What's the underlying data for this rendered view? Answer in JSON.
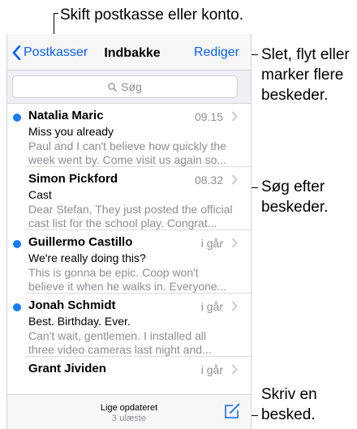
{
  "callouts": {
    "top": "Skift postkasse eller konto.",
    "edit": [
      "Slet, flyt eller",
      "marker flere",
      "beskeder."
    ],
    "search": [
      "Søg efter",
      "beskeder."
    ],
    "compose": [
      "Skriv en",
      "besked."
    ]
  },
  "navbar": {
    "back_label": "Postkasser",
    "title": "Indbakke",
    "edit_label": "Rediger"
  },
  "search": {
    "placeholder": "Søg"
  },
  "messages": [
    {
      "sender": "Natalia Maric",
      "time": "09.15",
      "subject": "Miss you already",
      "preview": [
        "Paul and I can't believe how quickly the",
        "week went by. Come visit us again so..."
      ],
      "unread": true
    },
    {
      "sender": "Simon Pickford",
      "time": "08.32",
      "subject": "Cast",
      "preview": [
        "Dear Stefan, They just posted the official",
        "cast list for the school play. Congrat..."
      ],
      "unread": false
    },
    {
      "sender": "Guillermo Castillo",
      "time": "i går",
      "subject": "We're really doing this?",
      "preview": [
        "This is gonna be epic. Coop won't",
        "believe it when he walks in. Everyone..."
      ],
      "unread": true
    },
    {
      "sender": "Jonah Schmidt",
      "time": "i går",
      "subject": "Best. Birthday. Ever.",
      "preview": [
        "Can't wait, gentlemen. I installed all",
        "three video cameras last night and..."
      ],
      "unread": true
    },
    {
      "sender": "Grant Jividen",
      "time": "i går",
      "subject": "",
      "preview": [
        "",
        ""
      ],
      "unread": false
    }
  ],
  "toolbar": {
    "status": "Lige opdateret",
    "unread_count": "3 ulæste"
  },
  "colors": {
    "accent": "#0a60ff",
    "unread_dot": "#1a7bff"
  },
  "icons": [
    "chevron-left-icon",
    "search-icon",
    "chevron-right-icon",
    "compose-icon"
  ]
}
